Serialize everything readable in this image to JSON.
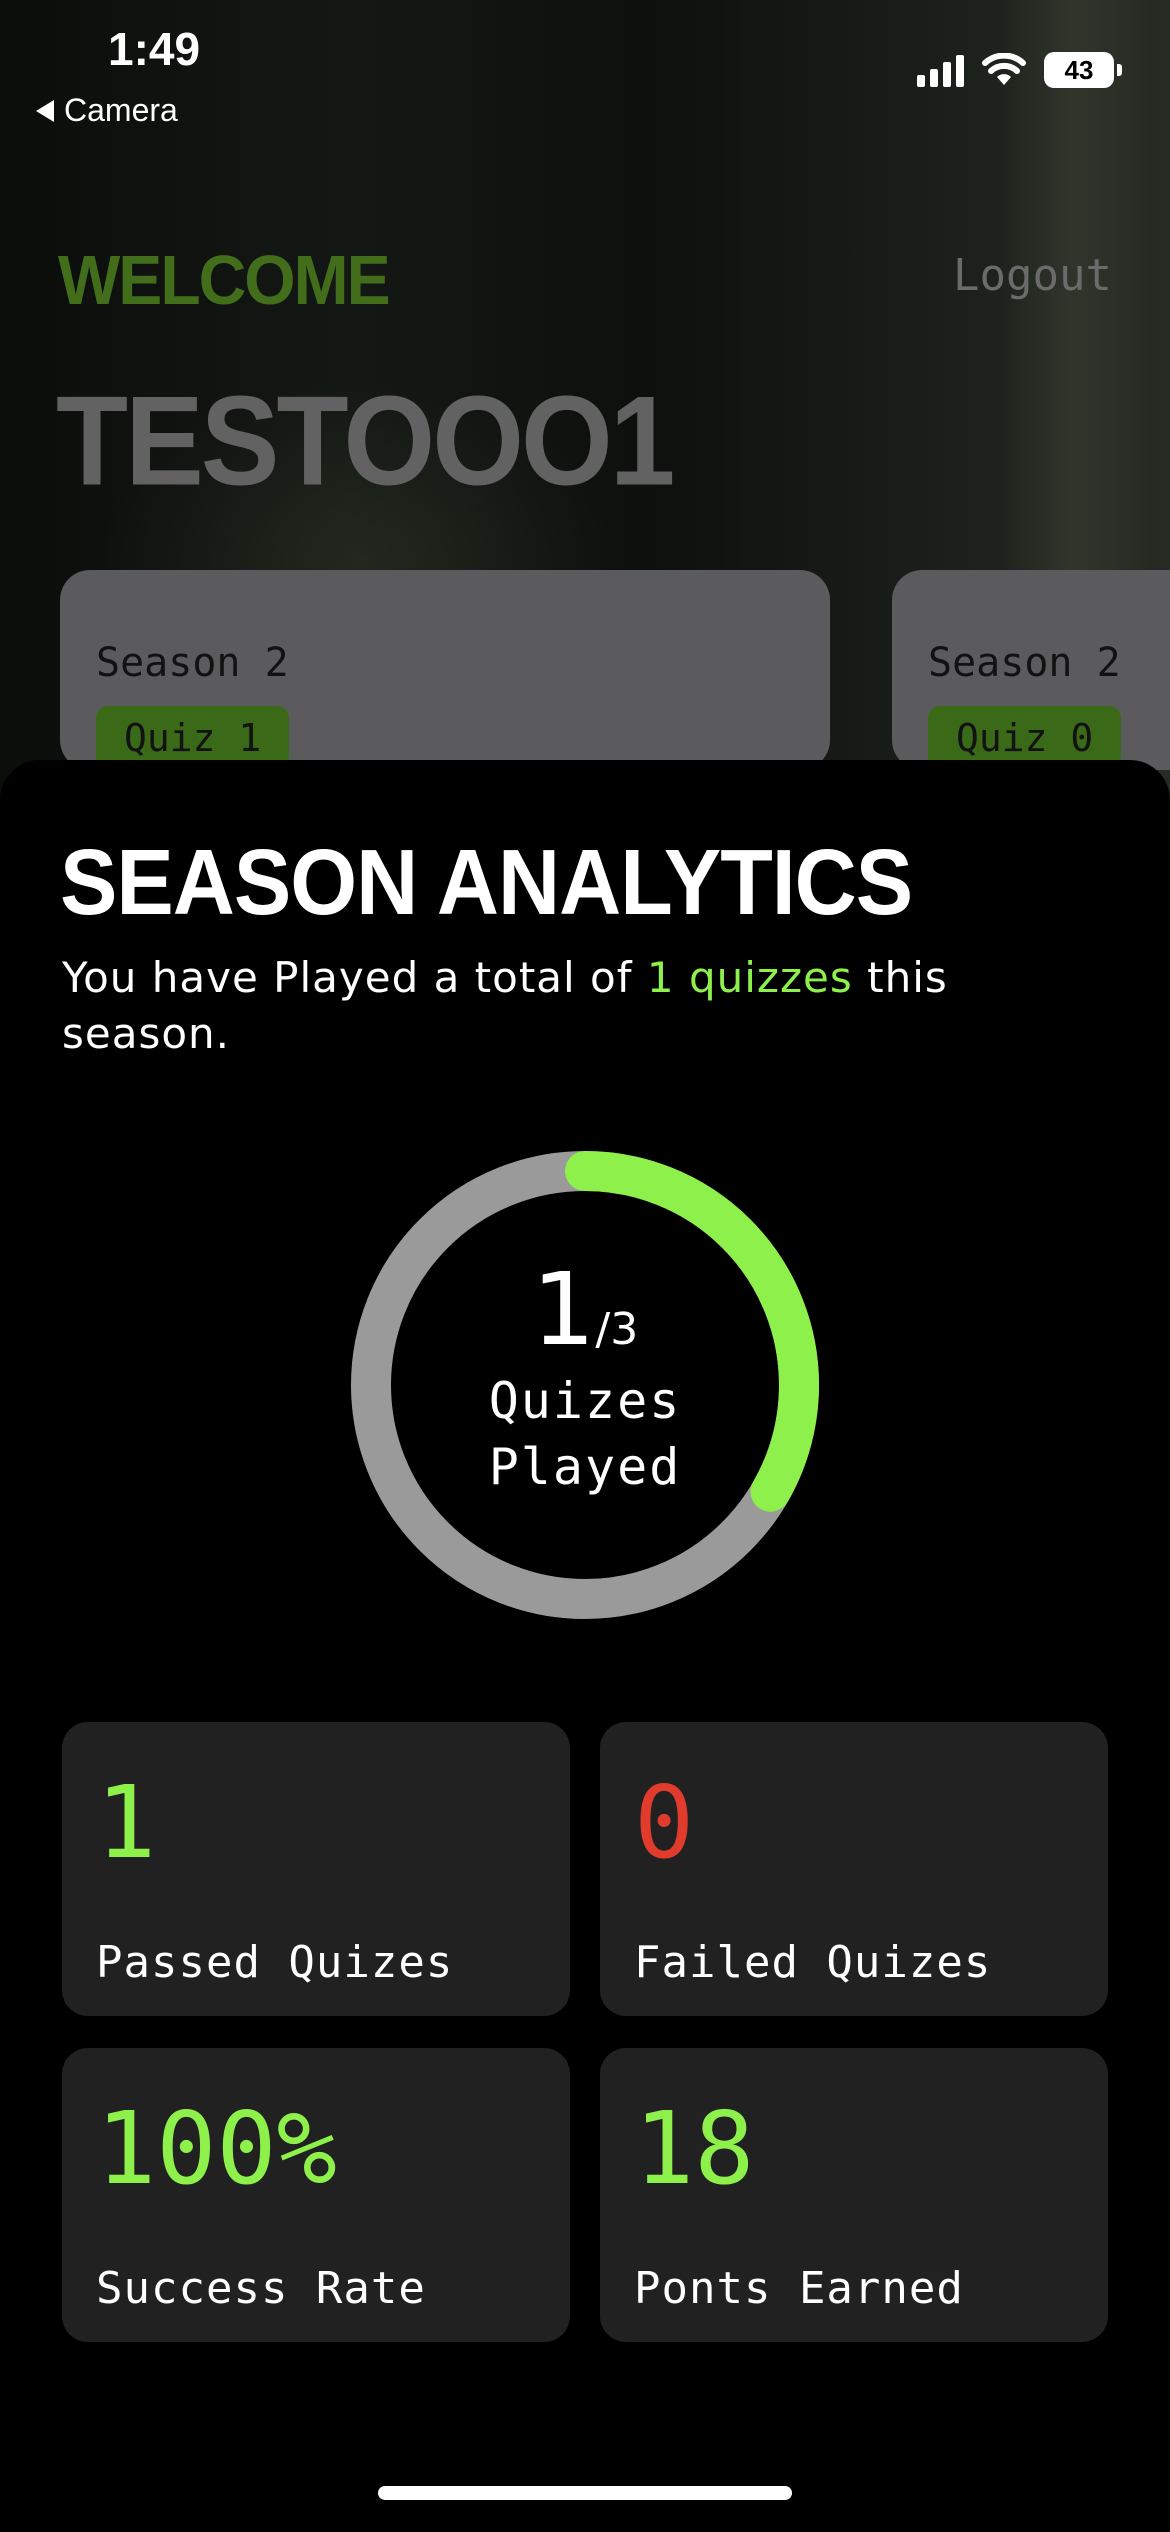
{
  "status_bar": {
    "time": "1:49",
    "back_app": "Camera",
    "battery": "43",
    "icons": [
      "signal-icon",
      "wifi-icon",
      "battery-icon"
    ]
  },
  "header": {
    "welcome": "WELCOME",
    "logout": "Logout",
    "username": "TESTOOO1"
  },
  "season_cards": [
    {
      "season": "Season 2",
      "quiz": "Quiz 1"
    },
    {
      "season": "Season 2",
      "quiz": "Quiz 0"
    }
  ],
  "analytics": {
    "title": "SEASON ANALYTICS",
    "subtitle_prefix": "You have Played a total of ",
    "subtitle_highlight": "1 quizzes",
    "subtitle_suffix": " this season.",
    "ring": {
      "played": "1",
      "total": "/3",
      "label_line1": "Quizes",
      "label_line2": "Played",
      "progress_fraction": 0.333
    },
    "stats": [
      {
        "value": "1",
        "label": "Passed Quizes",
        "color": "#8ef04a"
      },
      {
        "value": "0",
        "label": "Failed Quizes",
        "color": "#e03b2c"
      },
      {
        "value": "100%",
        "label": "Success Rate",
        "color": "#8ef04a"
      },
      {
        "value": "18",
        "label": "Ponts Earned",
        "color": "#8ef04a"
      }
    ]
  },
  "colors": {
    "accent_green": "#8ef04a",
    "dark_green": "#426e1c",
    "fail_red": "#e03b2c",
    "tile_bg": "#212121",
    "ring_track": "#9a9a9a"
  }
}
